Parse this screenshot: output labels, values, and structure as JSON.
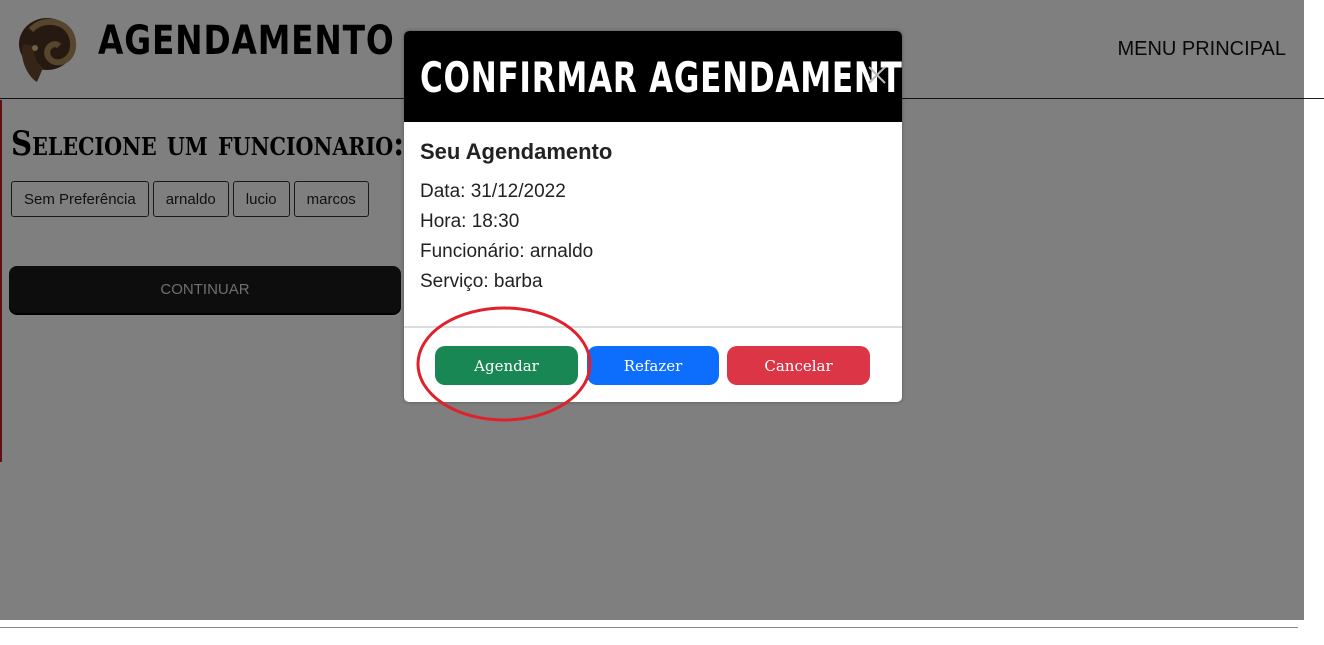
{
  "navbar": {
    "brand": "AGENDAMENTO",
    "menu_link": "MENU PRINCIPAL",
    "logo_icon": "ram-logo-icon"
  },
  "main": {
    "title": "Selecione um funcionario:",
    "employees": [
      "Sem Preferência",
      "arnaldo",
      "lucio",
      "marcos"
    ],
    "continue_label": "CONTINUAR"
  },
  "modal": {
    "title": "CONFIRMAR AGENDAMENTO",
    "close_icon": "close-icon",
    "heading": "Seu Agendamento",
    "date_line": "Data: 31/12/2022",
    "time_line": "Hora: 18:30",
    "employee_line": "Funcionário: arnaldo",
    "service_line": "Serviço: barba",
    "buttons": {
      "agendar": "Agendar",
      "refazer": "Refazer",
      "cancelar": "Cancelar"
    }
  },
  "colors": {
    "agendar": "#198754",
    "refazer": "#0d6efd",
    "cancelar": "#dc3545",
    "annotation": "#e0202a"
  }
}
